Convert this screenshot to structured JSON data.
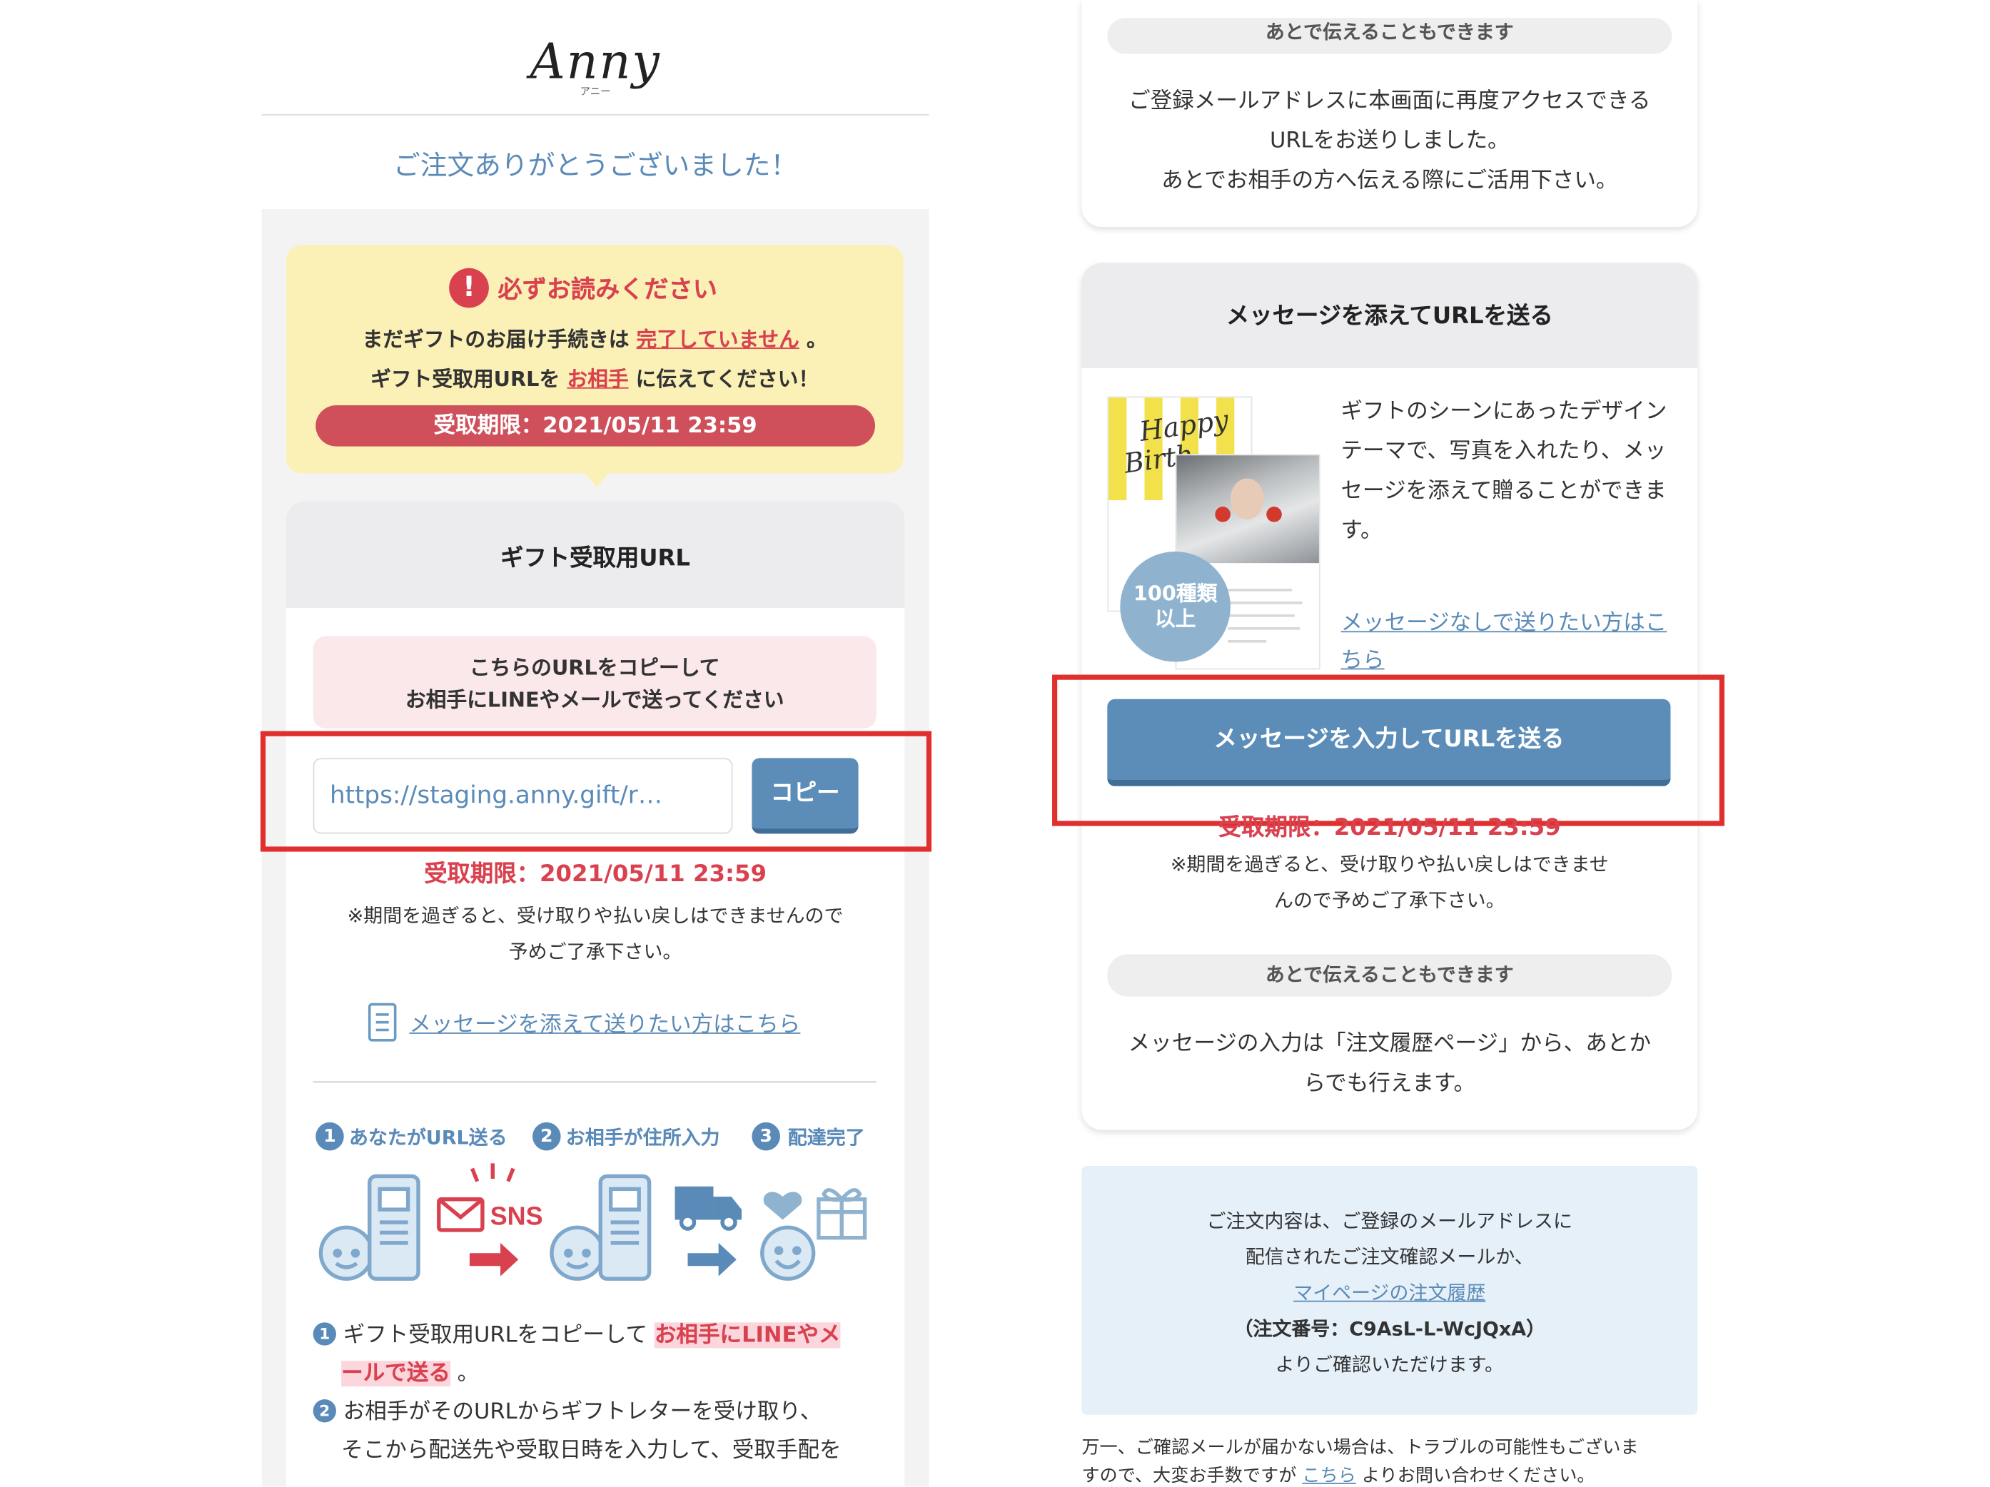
{
  "left": {
    "logo": "Anny",
    "logo_sub": "アニー",
    "thanks": "ご注文ありがとうございました！",
    "notice": {
      "icon": "exclamation-circle-icon",
      "icon_glyph": "!",
      "title": "必ずお読みください",
      "line1_pre": "まだギフトのお届け手続きは",
      "line1_link": "完了していません",
      "line1_post": "。",
      "line2_pre": "ギフト受取用URLを",
      "line2_link": "お相手",
      "line2_post": "に伝えてください！",
      "deadline": "受取期限：2021/05/11 23:59"
    },
    "card_title": "ギフト受取用URL",
    "copy_note_line1": "こちらのURLをコピーして",
    "copy_note_line2": "お相手にLINEやメールで送ってください",
    "url_value": "https://staging.anny.gift/r…",
    "copy_button": "コピー",
    "deadline": "受取期限：2021/05/11 23:59",
    "period_line1": "※期間を過ぎると、受け取りや払い戻しはできませんので",
    "period_line2": "予めご了承下さい。",
    "message_link": "メッセージを添えて送りたい方はこちら",
    "steps": [
      {
        "num": "1",
        "label": "あなたがURL送る"
      },
      {
        "num": "2",
        "label": "お相手が住所入力"
      },
      {
        "num": "3",
        "label": "配達完了"
      }
    ],
    "sns_label": "SNS",
    "desc1_num": "1",
    "desc1_pre": "ギフト受取用URLをコピーして",
    "desc1_hl1": "お相手にLINEやメ",
    "desc1_hl2": "ールで送る",
    "desc1_post": "。",
    "desc2_num": "2",
    "desc2_line1": "お相手がそのURLからギフトレターを受け取り、",
    "desc2_line2": "そこから配送先や受取日時を入力して、受取手配を"
  },
  "right": {
    "later_top": "あとで伝えることもできます",
    "top_text_line1": "ご登録メールアドレスに本画面に再度アクセスできる",
    "top_text_line2": "URLをお送りしました。",
    "top_text_line3": "あとでお相手の方へ伝える際にご活用下さい。",
    "card_title": "メッセージを添えてURLを送る",
    "thumb_happy": "Happy",
    "thumb_birth": "Birth",
    "badge_line1": "100種類",
    "badge_line2": "以上",
    "gift_text": "ギフトのシーンにあったデザインテーマで、写真を入れたり、メッセージを添えて贈ることができます。",
    "nomsg_link": "メッセージなしで送りたい方はこちら",
    "send_button": "メッセージを入力してURLを送る",
    "deadline": "受取期限：2021/05/11 23:59",
    "period_line1": "※期間を過ぎると、受け取りや払い戻しはできませ",
    "period_line2": "んので予めご了承下さい。",
    "later_label": "あとで伝えることもできます",
    "later_text_line1": "メッセージの入力は「注文履歴ページ」から、あとか",
    "later_text_line2": "らでも行えます。",
    "info_line1": "ご注文内容は、ご登録のメールアドレスに",
    "info_line2": "配信されたご注文確認メールか、",
    "info_link": "マイページの注文履歴",
    "info_order": "（注文番号：C9AsL-L-WcJQxA）",
    "info_line3": "よりご確認いただけます。",
    "foot_line1": "万一、ご確認メールが届かない場合は、トラブルの可能性もございま",
    "foot_line2_pre": "すので、大変お手数ですが",
    "foot_link": "こちら",
    "foot_line2_post": "よりお問い合わせください。"
  },
  "colors": {
    "accent_blue": "#5b8db8",
    "alert_red": "#d9414f",
    "notice_yellow": "#fbf1b7",
    "highlight_box": "#e0302e"
  }
}
